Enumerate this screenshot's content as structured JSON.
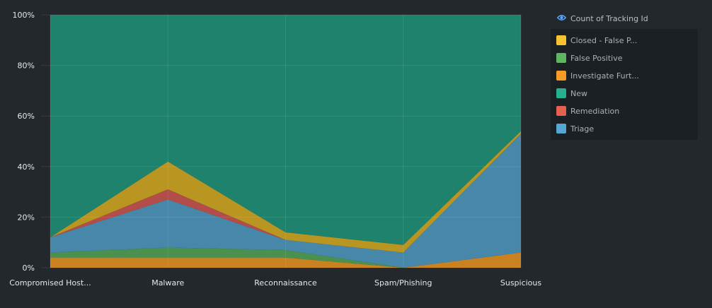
{
  "chart_data": {
    "type": "area",
    "stacked_percent": true,
    "categories": [
      "Compromised Host...",
      "Malware",
      "Reconnaissance",
      "Spam/Phishing",
      "Suspicious"
    ],
    "series": [
      {
        "name": "Investigate Furt...",
        "color": "#d98a1f",
        "values": [
          4,
          4,
          4,
          0,
          6
        ]
      },
      {
        "name": "False Positive",
        "color": "#4e9a52",
        "values": [
          2,
          4,
          3,
          0,
          0
        ]
      },
      {
        "name": "Triage",
        "color": "#4b8fb5",
        "values": [
          6,
          19,
          4,
          6,
          47
        ]
      },
      {
        "name": "Remediation",
        "color": "#c0504d",
        "values": [
          0,
          4,
          0,
          0,
          0
        ]
      },
      {
        "name": "Closed - False P...",
        "color": "#c7a021",
        "values": [
          0,
          11,
          3,
          3,
          1
        ]
      },
      {
        "name": "New",
        "color": "#1f8a72",
        "values": [
          88,
          58,
          86,
          91,
          46
        ]
      }
    ],
    "yticks": [
      "100%",
      "80%",
      "60%",
      "40%",
      "20%",
      "0%"
    ],
    "ylim": [
      0,
      100
    ],
    "grid": true,
    "legend_position": "right"
  },
  "legend": {
    "title": "Count of Tracking Id",
    "items": [
      {
        "label": "Closed - False P...",
        "color": "#f5c231"
      },
      {
        "label": "False Positive",
        "color": "#5eb562"
      },
      {
        "label": "Investigate Furt...",
        "color": "#f59b26"
      },
      {
        "label": "New",
        "color": "#26b08d"
      },
      {
        "label": "Remediation",
        "color": "#e4604f"
      },
      {
        "label": "Triage",
        "color": "#56a6d2"
      }
    ]
  }
}
